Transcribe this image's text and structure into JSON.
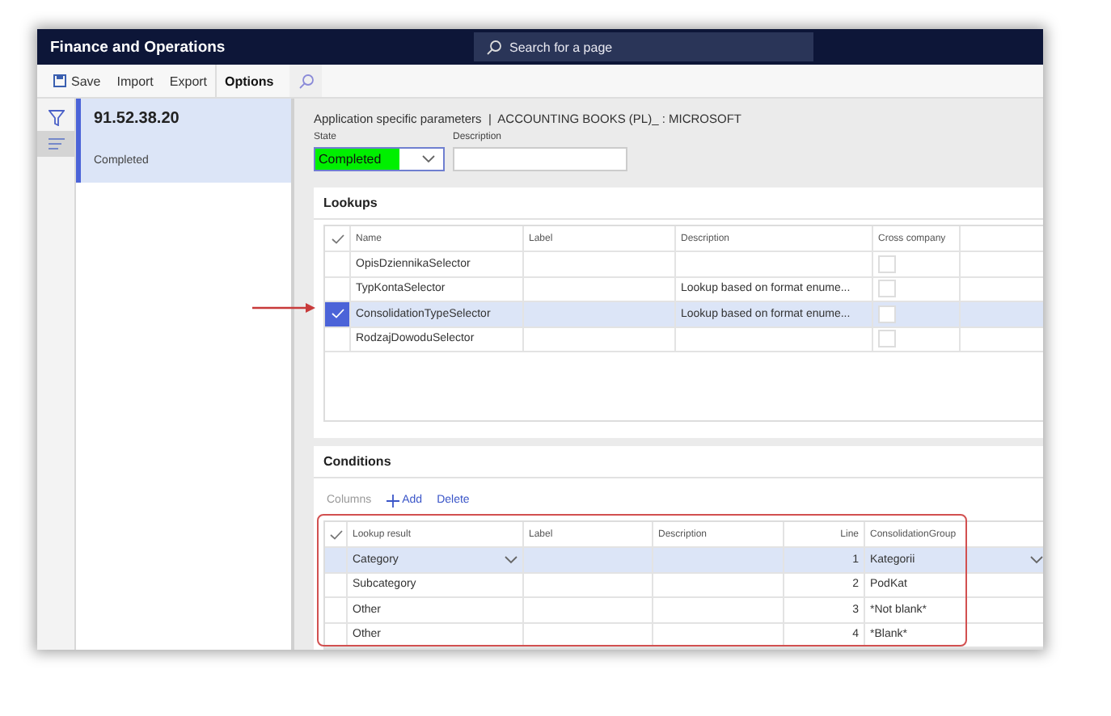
{
  "app": {
    "title": "Finance and Operations",
    "search": {
      "placeholder": "Search for a page"
    }
  },
  "toolbar": [
    {
      "label": "Save",
      "kind": "save"
    },
    {
      "label": "Import",
      "kind": "plain"
    },
    {
      "label": "Export",
      "kind": "plain"
    },
    {
      "label": "Options",
      "kind": "strong"
    }
  ],
  "rail": [
    {
      "kind": "filter",
      "selected": false
    },
    {
      "kind": "list",
      "selected": true
    }
  ],
  "versions": [
    {
      "number": "91.52.38.20",
      "status": "Completed",
      "selected": true
    }
  ],
  "breadcrumb": "Application specific parameters  |  ACCOUNTING BOOKS (PL)_ : MICROSOFT",
  "state": {
    "label": "State",
    "value": "Completed"
  },
  "description": {
    "label": "Description"
  },
  "lookups": {
    "title": "Lookups",
    "columns": [
      "Name",
      "Label",
      "Description",
      "Cross company"
    ],
    "rows": [
      {
        "name": "OpisDziennikaSelector",
        "cross_company": false,
        "selected": false
      },
      {
        "name": "TypKontaSelector",
        "description": "Lookup based on format enume...",
        "cross_company": false,
        "selected": false
      },
      {
        "name": "ConsolidationTypeSelector",
        "description": "Lookup based on format enume...",
        "cross_company": false,
        "selected": true
      },
      {
        "name": "RodzajDowoduSelector",
        "cross_company": false,
        "selected": false
      }
    ]
  },
  "conditions": {
    "title": "Conditions",
    "actions": [
      {
        "label": "Columns",
        "kind": "plain",
        "disabled": true
      },
      {
        "label": "Add",
        "kind": "add",
        "disabled": false
      },
      {
        "label": "Delete",
        "kind": "plain",
        "disabled": false
      }
    ],
    "columns": [
      "Lookup result",
      "Label",
      "Description",
      "Line",
      "ConsolidationGroup"
    ],
    "rows": [
      {
        "lookup_result": "Category",
        "line": "1",
        "consolidation_group": "Kategorii",
        "selected": true
      },
      {
        "lookup_result": "Subcategory",
        "line": "2",
        "consolidation_group": "PodKat",
        "selected": false
      },
      {
        "lookup_result": "Other",
        "line": "3",
        "consolidation_group": "*Not blank*",
        "selected": false
      },
      {
        "lookup_result": "Other",
        "line": "4",
        "consolidation_group": "*Blank*",
        "selected": false
      }
    ]
  }
}
